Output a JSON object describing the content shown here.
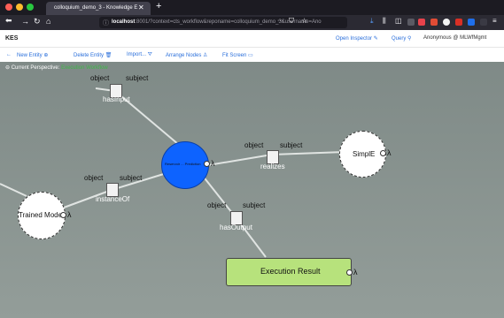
{
  "browser": {
    "tab_title": "colloquium_demo_3 - Knowledge E",
    "tab_close": "✕",
    "new_tab": "+",
    "url_host": "localhost",
    "url_rest": ":8001/?context=cts_workflow&reponame=colloquium_demo_3&username=Ano",
    "url_more": "···"
  },
  "app": {
    "name": "KES",
    "open_inspector": "Open Inspector",
    "query": "Query",
    "user": "Anonymous @ MLWfMgmt"
  },
  "toolbar": {
    "new_entity": "New Entity",
    "delete_entity": "Delete Entity",
    "import": "Import...",
    "arrange": "Arrange Nodes",
    "fit": "Fit Screen"
  },
  "canvas": {
    "perspective_label": "Current Perspective:",
    "perspective_name": "Execution Workflow"
  },
  "relations": [
    {
      "object": "object",
      "subject": "subject",
      "name": "hasInput"
    },
    {
      "object": "object",
      "subject": "subject",
      "name": "realizes"
    },
    {
      "object": "object",
      "subject": "subject",
      "name": "instanceOf"
    },
    {
      "object": "object",
      "subject": "subject",
      "name": "hasOutput"
    }
  ],
  "nodes": {
    "center": "Reservoir ... Prediction",
    "simple": "SimplE",
    "trained": "Trained Model",
    "result": "Execution Result",
    "lambda": "λ"
  },
  "colors": {
    "center_fill": "#0d63ff",
    "result_fill": "#b7e27c",
    "link": "#2a6fdb",
    "perspective_accent": "#3db847"
  }
}
